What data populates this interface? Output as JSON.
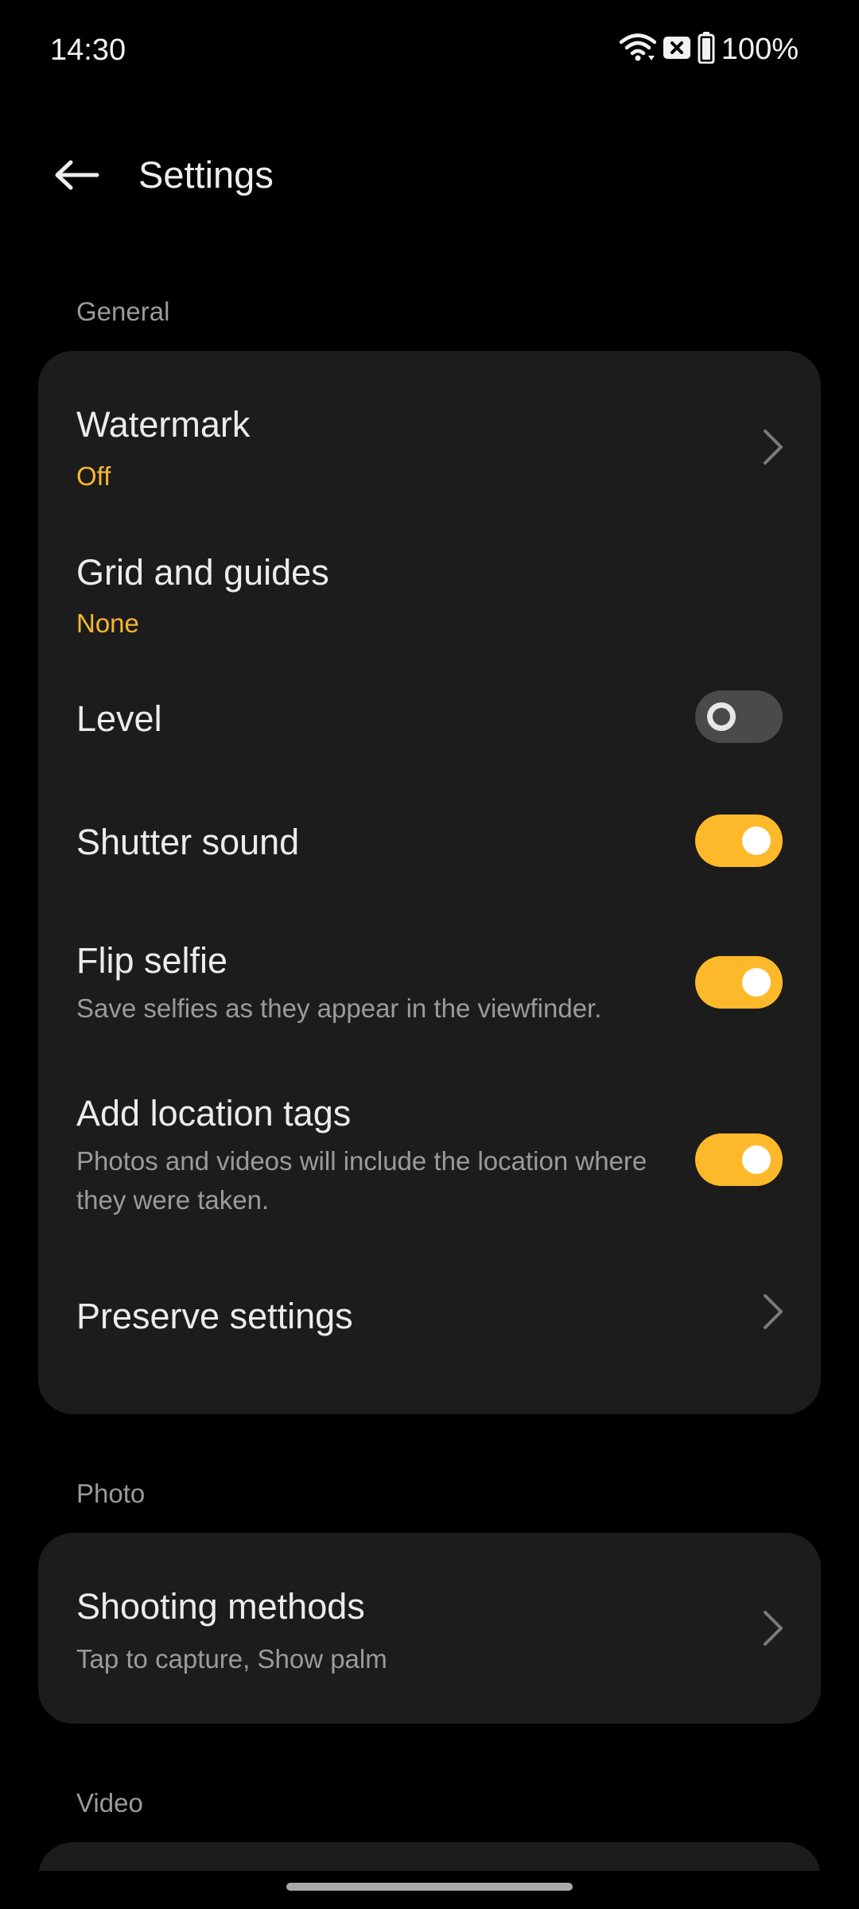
{
  "status_bar": {
    "time": "14:30",
    "battery": "100%",
    "icons": [
      "wifi-icon",
      "notification-x-icon",
      "battery-icon"
    ]
  },
  "header": {
    "back_icon": "arrow-left-icon",
    "title": "Settings"
  },
  "sections": {
    "general": {
      "label": "General",
      "items": {
        "watermark": {
          "title": "Watermark",
          "value": "Off"
        },
        "grid": {
          "title": "Grid and guides",
          "value": "None"
        },
        "level": {
          "title": "Level",
          "enabled": false
        },
        "shutter": {
          "title": "Shutter sound",
          "enabled": true
        },
        "flip": {
          "title": "Flip selfie",
          "subtitle": "Save selfies as they appear in the viewfinder.",
          "enabled": true
        },
        "location": {
          "title": "Add location tags",
          "subtitle": "Photos and videos will include the location where they were taken.",
          "enabled": true
        },
        "preserve": {
          "title": "Preserve settings"
        }
      }
    },
    "photo": {
      "label": "Photo",
      "items": {
        "shooting": {
          "title": "Shooting methods",
          "subtitle": "Tap to capture, Show palm"
        }
      }
    },
    "video": {
      "label": "Video"
    }
  },
  "colors": {
    "accent": "#FDB92A",
    "accent_text": "#F7B731",
    "card_bg": "#1C1C1C",
    "background": "#000000"
  }
}
